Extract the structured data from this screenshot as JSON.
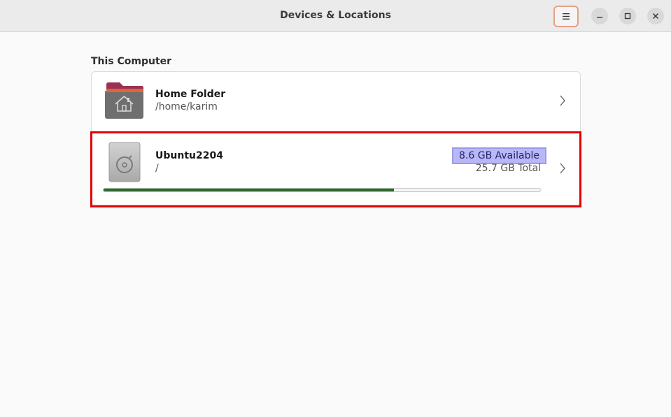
{
  "window": {
    "title": "Devices & Locations"
  },
  "header": {
    "menu_icon": "hamburger-menu-icon",
    "controls": [
      "minimize-icon",
      "maximize-icon",
      "close-icon"
    ]
  },
  "section": {
    "title": "This Computer"
  },
  "items": [
    {
      "name": "Home Folder",
      "path": "/home/karim",
      "icon": "home-folder-icon"
    },
    {
      "name": "Ubuntu2204",
      "path": "/",
      "icon": "disk-drive-icon",
      "available": "8.6 GB Available",
      "total": "25.7 GB Total",
      "used_fraction": 0.665
    }
  ],
  "colors": {
    "accent": "#e95420",
    "usage_fill": "#2d6b2d",
    "selection_highlight": "#b8b8f6",
    "annotation_box": "#e30000"
  }
}
